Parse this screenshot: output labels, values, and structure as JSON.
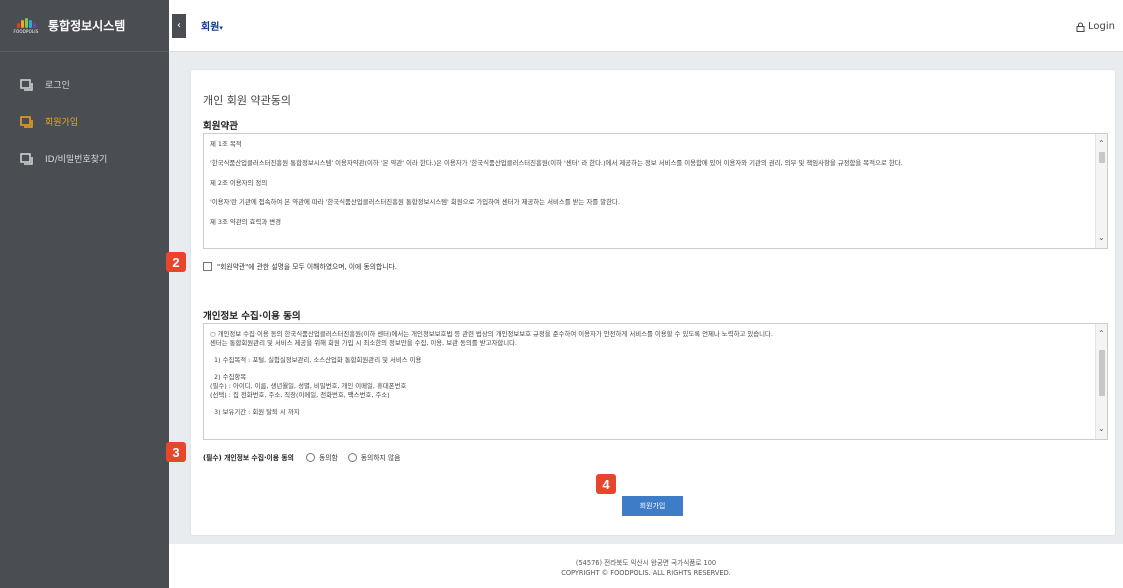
{
  "sidebar": {
    "logo_text": "FOODPOLIS",
    "title": "통합정보시스템",
    "items": [
      {
        "label": "로그인",
        "active": false
      },
      {
        "label": "회원가입",
        "active": true
      },
      {
        "label": "ID/비밀번호찾기",
        "active": false
      }
    ]
  },
  "topbar": {
    "collapse_icon": "‹",
    "menu_label": "회원",
    "menu_caret": "▾",
    "login_label": "Login"
  },
  "page": {
    "title": "개인 회원 약관동의"
  },
  "terms": {
    "section_title": "회원약관",
    "paragraphs": [
      "제 1조 목적",
      "'한국식품산업클러스터진흥원 통합정보시스템' 이용자약관(이하 '본 약관' 이라 한다.)은 이용자가 '한국식품산업클러스터진흥원(이하 '센터' 라 한다.)에서 제공하는 정보 서비스를 이용함에 있어 이용자와 기관의 권리, 의무 및 책임사항을 규정함을 목적으로 한다.",
      "제 2조 이용자의 정의",
      "'이용자'란 기관에 접속하여 본 약관에 따라 '한국식품산업클러스터진흥원 통합정보시스템' 회원으로 가입하여 센터가 제공하는 서비스를 받는 자를 말한다.",
      "제 3조 약관의 효력과 변경"
    ],
    "agree_label": "\"회원약관\"에 관한 설명을 모두 이해하였으며, 이에 동의합니다."
  },
  "privacy": {
    "section_title": "개인정보 수집·이용 동의",
    "lines": [
      "○ 개인정보 수집·이용 동의 한국식품산업클러스터진흥원(이하 센터)에서는 개인정보보호법 등 관련 법상의 개인정보보호 규정을 준수하여 이용자가 안전하게 서비스를 이용할 수 있도록 언제나 노력하고 있습니다.",
      "센터는 통합회원관리 및 서비스 제공을 위해 회원 가입 시 최소한의 정보만을 수집, 이용, 보관 동의를 받고자합니다.",
      "",
      "1) 수집목적 : 포털, 실험실정보관리, 소스산업화 통합회원관리 및 서비스 이용",
      "",
      "2) 수집항목",
      "(필수) : 아이디, 이름, 생년월일, 성별, 비밀번호, 개인 이메일, 휴대폰번호",
      "(선택) : 집 전화번호, 주소, 직장(이메일, 전화번호, 팩스번호, 주소)",
      "",
      "3) 보유기간 : 회원 탈퇴 시 까지"
    ],
    "required_label": "(필수) 개인정보 수집·이용 동의",
    "option_agree": "동의함",
    "option_disagree": "동의하지 않음"
  },
  "join_button": "회원가입",
  "badges": [
    "2",
    "3",
    "4"
  ],
  "footer": {
    "address": "(54576) 전라북도 익산시 왕궁면 국가식품로 100",
    "copyright": "COPYRIGHT © FOODPOLIS. ALL RIGHTS RESERVED."
  },
  "colors": {
    "sidebar_bg": "#4a4d52",
    "active": "#f3a417",
    "brand_blue": "#0d3a8c",
    "button": "#3f7cc7",
    "badge": "#e8452c"
  },
  "icons": {
    "menu_item": "window-icon",
    "login": "lock-icon"
  }
}
